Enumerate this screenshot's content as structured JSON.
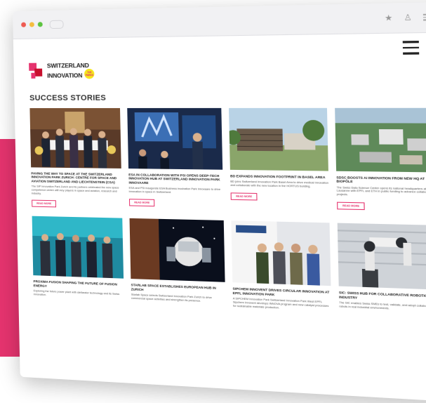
{
  "brand": {
    "line1": "SWITZERLAND",
    "line2": "INNOVATION",
    "badge": "THE PARKS",
    "accent": "#e5336e",
    "dark_red": "#c8102e",
    "badge_color": "#f5e61a"
  },
  "page": {
    "section_title": "SUCCESS STORIES"
  },
  "cards": [
    {
      "title": "PAVING THE WAY TO SPACE AT THE SWITZERLAND INNOVATION PARK ZURICH: CENTRE FOR SPACE AND AVIATION SWITZERLAND AND LIECHTENSTEIN (CSA)",
      "text": "The SIP Innovation Park Zurich and its partners celebrated the new space competence centre with key players in space and aviation, research and industry.",
      "cta": "READ MORE"
    },
    {
      "title": "ESA IN COLLABORATION WITH PSI OPENS DEEP-TECH INNOVATION HUB AT SWITZERLAND INNOVATION PARK INNOVAARE",
      "text": "ESA and PSI inaugurate ESA Business incubation Park Innovaare to drive innovation in space in Switzerland.",
      "cta": "READ MORE"
    },
    {
      "title": "BD EXPANDS INNOVATION FOOTPRINT IN BASEL AREA",
      "text": "BD joins Switzerland Innovation Park Basel Area to drive medical innovation and collaborate with the new location in the HORTUS building.",
      "cta": "READ MORE"
    },
    {
      "title": "SDSC BOOSTS AI INNOVATION FROM NEW HQ AT BIOPÔLE",
      "text": "The Swiss Data Science Center opens its national headquarters at Biopôle Lausanne with EPFL and ETH in public funding to advance collaborative AI projects.",
      "cta": "READ MORE"
    },
    {
      "title": "PROXIMA FUSION SHAPING THE FUTURE OF FUSION ENERGY",
      "text": "Exploring the future power plant with stellarator technology and its Swiss innovation.",
      "cta": ""
    },
    {
      "title": "STARLAB SPACE ESTABLISHES EUROPEAN HUB IN ZURICH",
      "text": "Starlab Space selects Switzerland Innovation Park Zurich to drive commercial space activities and strengthen its presence.",
      "cta": ""
    },
    {
      "title": "SIPCHEM INNOVENT DRIVES CIRCULAR INNOVATION AT EPFL INNOVATION PARK",
      "text": "A SIPCHEM Innovation Park Switzerland Innovation Park West EPFL Sipchem Innovent develops INNOVA program and new catalyst processes for sustainable materials production.",
      "cta": ""
    },
    {
      "title": "SIC: SWISS HUB FOR COLLABORATIVE ROBOTICS IN INDUSTRY",
      "text": "The SIC enables Swiss SMEs to test, validate, and adopt collaborative robots in real industrial environments.",
      "cta": ""
    }
  ]
}
